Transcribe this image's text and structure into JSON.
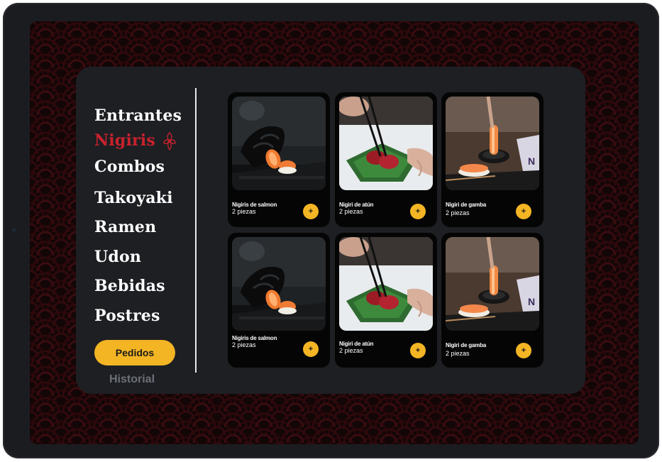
{
  "menu": {
    "categories": [
      "Entrantes",
      "Nigiris",
      "Combos",
      "Takoyaki",
      "Ramen",
      "Udon",
      "Bebidas",
      "Postres"
    ],
    "active_category": "Nigiris",
    "active_icon": "sakura-flower-icon",
    "orders_button": "Pedidos",
    "history_link": "Historial"
  },
  "products": [
    {
      "name": "Nigiris de salmon",
      "pieces": "2 piezas",
      "add_label": "+",
      "image": "salmon-nigiri-photo"
    },
    {
      "name": "Nigiri de atún",
      "pieces": "2 piezas",
      "add_label": "+",
      "image": "tuna-nigiri-photo"
    },
    {
      "name": "Nigiri de gamba",
      "pieces": "2 piezas",
      "add_label": "+",
      "image": "shrimp-nigiri-photo"
    },
    {
      "name": "Nigiris de salmon",
      "pieces": "2 piezas",
      "add_label": "+",
      "image": "salmon-nigiri-photo"
    },
    {
      "name": "Nigiri de atún",
      "pieces": "2 piezas",
      "add_label": "+",
      "image": "tuna-nigiri-photo"
    },
    {
      "name": "Nigiri de gamba",
      "pieces": "2 piezas",
      "add_label": "+",
      "image": "shrimp-nigiri-photo"
    }
  ],
  "colors": {
    "accent": "#f3b524",
    "active_category": "#c8222d",
    "panel": "#1e1f23",
    "card": "#050505",
    "muted_text": "#6c7077"
  }
}
